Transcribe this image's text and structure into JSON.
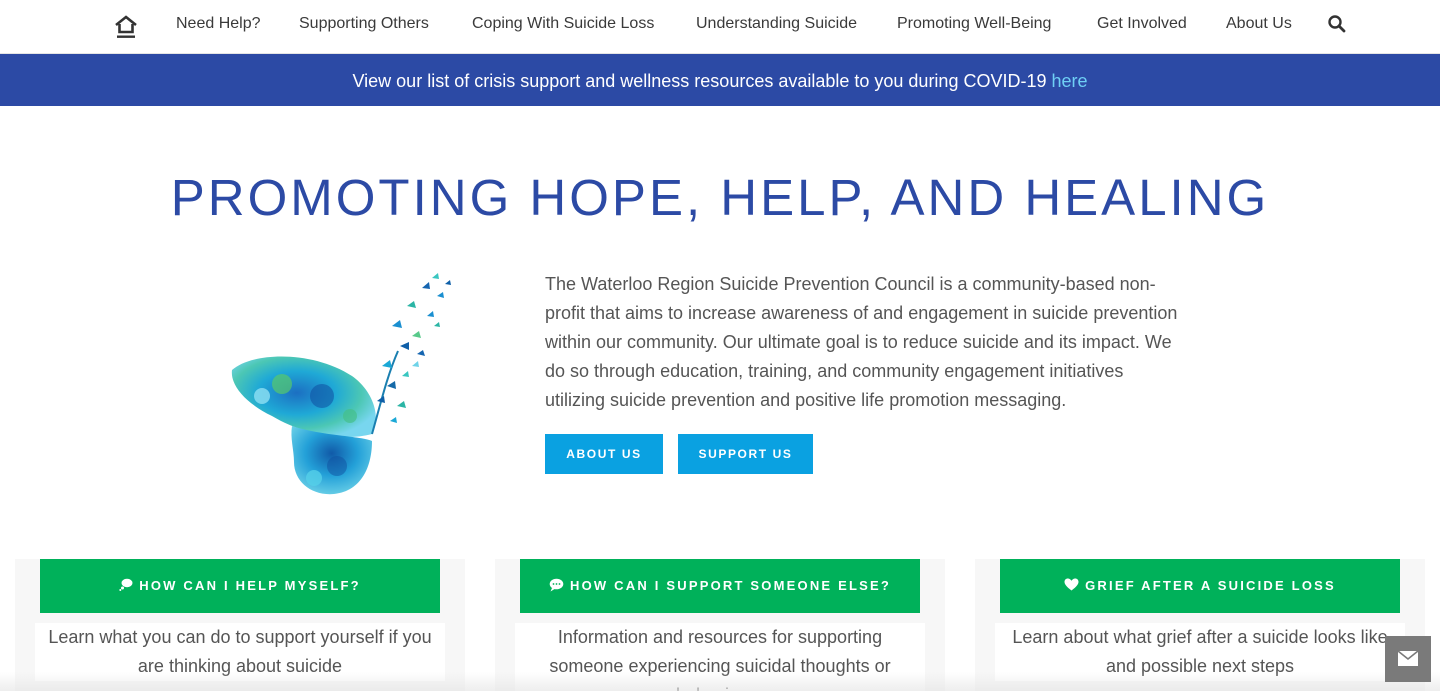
{
  "nav": {
    "home_icon": "home-icon",
    "items": [
      {
        "label": "Need Help?"
      },
      {
        "label": "Supporting Others"
      },
      {
        "label": "Coping With Suicide Loss"
      },
      {
        "label": "Understanding Suicide"
      },
      {
        "label": "Promoting Well-Being"
      },
      {
        "label": "Get Involved"
      },
      {
        "label": "About Us"
      }
    ],
    "search_icon": "search-icon"
  },
  "banner": {
    "text": "View our list of crisis support and wellness resources available to you during COVID-19 ",
    "link": "here",
    "bg_color": "#2c4aa5",
    "link_color": "#6fd0f5"
  },
  "hero": {
    "title": "PROMOTING HOPE, HELP, AND HEALING",
    "title_color": "#2c4aa5",
    "image": "butterfly-illustration",
    "intro": "The Waterloo Region Suicide Prevention Council is a community-based non-profit that aims to increase awareness of and engagement in suicide prevention within our community. Our ultimate goal is to reduce suicide and its impact. We do so through education, training, and community engagement initiatives utilizing suicide prevention and positive life promotion messaging.",
    "buttons": {
      "about": "ABOUT US",
      "support": "SUPPORT US"
    },
    "button_color": "#0aa1e1"
  },
  "cards": [
    {
      "icon": "thought-bubble-icon",
      "title": "HOW CAN I HELP MYSELF?",
      "description": "Learn what you can do to support yourself if you are thinking about suicide"
    },
    {
      "icon": "speech-bubble-icon",
      "title": "HOW CAN I SUPPORT SOMEONE ELSE?",
      "description": "Information and resources for supporting someone experiencing suicidal thoughts or behaviours"
    },
    {
      "icon": "heart-icon",
      "title": "GRIEF AFTER A SUICIDE LOSS",
      "description": "Learn about what grief after a suicide looks like and possible next steps"
    }
  ],
  "card_color": "#00b15a",
  "contact_widget_icon": "envelope-icon"
}
